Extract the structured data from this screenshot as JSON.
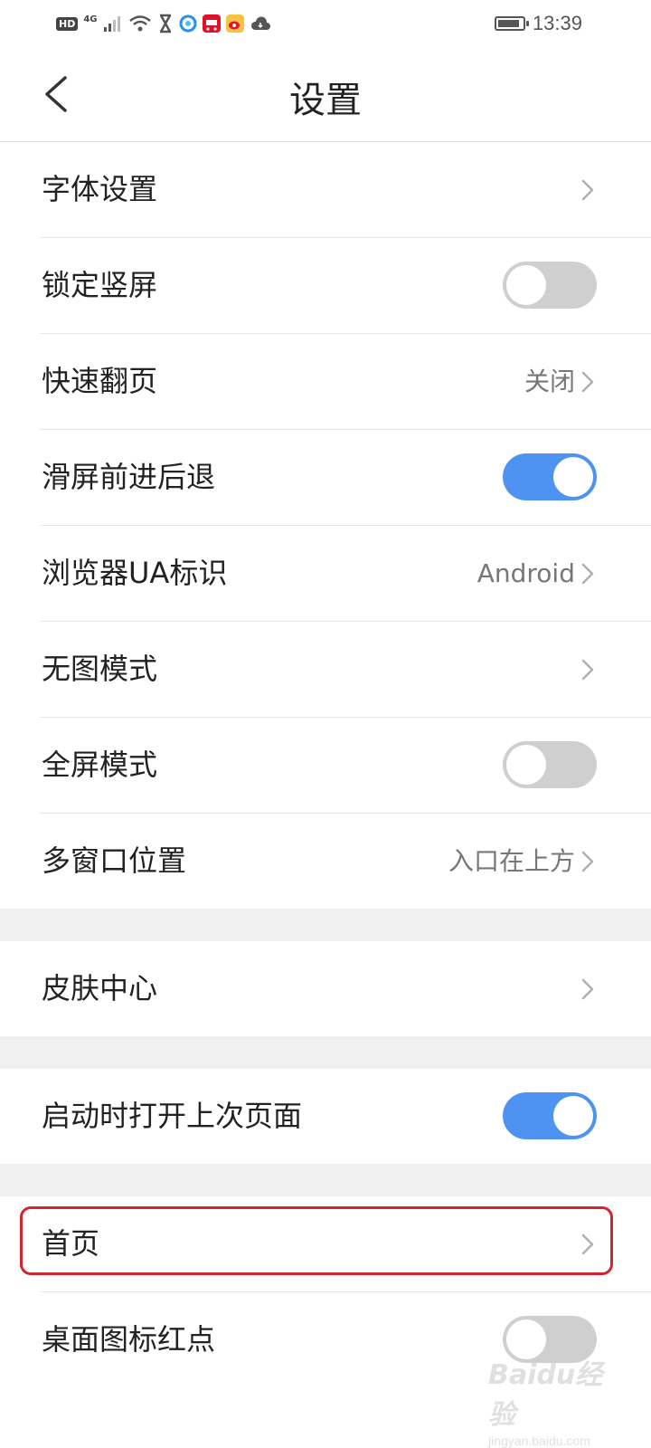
{
  "status_bar": {
    "hd": "HD",
    "network": "4G",
    "time": "13:39",
    "app_icons": [
      "wifi-icon",
      "hourglass-icon",
      "browser-icon",
      "tmall-icon",
      "weibo-icon",
      "cloud-icon"
    ]
  },
  "header": {
    "title": "设置"
  },
  "settings": [
    {
      "label": "字体设置",
      "control": "chevron"
    },
    {
      "label": "锁定竖屏",
      "control": "toggle",
      "on": false
    },
    {
      "label": "快速翻页",
      "control": "value",
      "value": "关闭"
    },
    {
      "label": "滑屏前进后退",
      "control": "toggle",
      "on": true
    },
    {
      "label": "浏览器UA标识",
      "control": "value",
      "value": "Android"
    },
    {
      "label": "无图模式",
      "control": "chevron"
    },
    {
      "label": "全屏模式",
      "control": "toggle",
      "on": false
    },
    {
      "label": "多窗口位置",
      "control": "value",
      "value": "入口在上方"
    },
    {
      "label": "皮肤中心",
      "control": "chevron"
    },
    {
      "label": "启动时打开上次页面",
      "control": "toggle",
      "on": true
    },
    {
      "label": "首页",
      "control": "chevron",
      "highlighted": true
    },
    {
      "label": "桌面图标红点",
      "control": "toggle",
      "on": false
    }
  ],
  "colors": {
    "toggle_on": "#4e93f2",
    "toggle_off": "#cfcfcf",
    "highlight": "#d0262f"
  },
  "watermark": {
    "main": "Baidu经验",
    "sub": "jingyan.baidu.com"
  }
}
